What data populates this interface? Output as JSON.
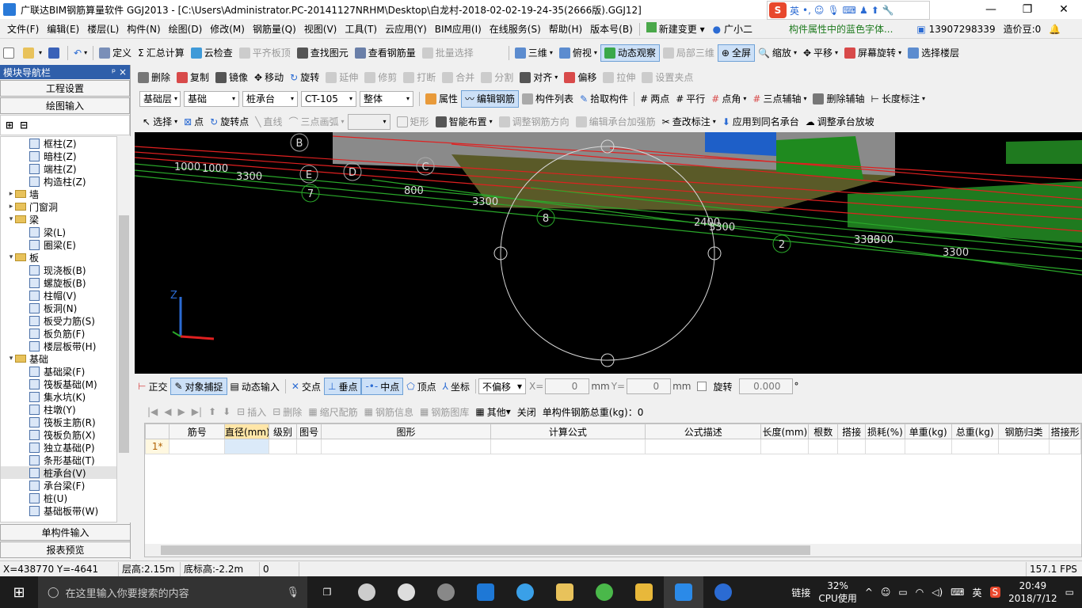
{
  "title": "广联达BIM钢筋算量软件 GGJ2013 - [C:\\Users\\Administrator.PC-20141127NRHM\\Desktop\\白龙村-2018-02-02-19-24-35(2666版).GGJ12]",
  "ime": {
    "lang": "英"
  },
  "menu": [
    "文件(F)",
    "编辑(E)",
    "楼层(L)",
    "构件(N)",
    "绘图(D)",
    "修改(M)",
    "钢筋量(Q)",
    "视图(V)",
    "工具(T)",
    "云应用(Y)",
    "BIM应用(I)",
    "在线服务(S)",
    "帮助(H)",
    "版本号(B)"
  ],
  "menu_extra": {
    "new_change": "新建变更",
    "guang_xiao_er": "广小二",
    "hint": "构件属性中的蓝色字体...",
    "phone": "13907298339",
    "zaojiadou": "造价豆:0"
  },
  "toolbar1": [
    "定义",
    "汇总计算",
    "云检查",
    "平齐板顶",
    "查找图元",
    "查看钢筋量",
    "批量选择",
    "三维",
    "俯视",
    "动态观察",
    "局部三维",
    "全屏",
    "缩放",
    "平移",
    "屏幕旋转",
    "选择楼层"
  ],
  "toolbar2": [
    "删除",
    "复制",
    "镜像",
    "移动",
    "旋转",
    "延伸",
    "修剪",
    "打断",
    "合并",
    "分割",
    "对齐",
    "偏移",
    "拉伸",
    "设置夹点"
  ],
  "toolbar3": {
    "combos": [
      "基础层",
      "基础",
      "桩承台",
      "CT-105",
      "整体"
    ],
    "buttons": [
      "属性",
      "编辑钢筋",
      "构件列表",
      "拾取构件",
      "两点",
      "平行",
      "点角",
      "三点辅轴",
      "删除辅轴",
      "长度标注"
    ]
  },
  "toolbar4": [
    "选择",
    "点",
    "旋转点",
    "直线",
    "三点画弧",
    "矩形",
    "智能布置",
    "调整钢筋方向",
    "编辑承台加强筋",
    "查改标注",
    "应用到同名承台",
    "调整承台放坡"
  ],
  "nav": {
    "header": "模块导航栏",
    "pin": "ᵖ ×",
    "engineering": "工程设置",
    "drawing": "绘图输入",
    "single": "单构件输入",
    "report": "报表预览",
    "tree": [
      {
        "label": "框柱(Z)",
        "level": 2
      },
      {
        "label": "暗柱(Z)",
        "level": 2
      },
      {
        "label": "端柱(Z)",
        "level": 2
      },
      {
        "label": "构造柱(Z)",
        "level": 2
      },
      {
        "label": "墙",
        "level": 1,
        "folder": true,
        "open": false
      },
      {
        "label": "门窗洞",
        "level": 1,
        "folder": true,
        "open": false
      },
      {
        "label": "梁",
        "level": 1,
        "folder": true,
        "open": true
      },
      {
        "label": "梁(L)",
        "level": 2
      },
      {
        "label": "圈梁(E)",
        "level": 2
      },
      {
        "label": "板",
        "level": 1,
        "folder": true,
        "open": true
      },
      {
        "label": "现浇板(B)",
        "level": 2
      },
      {
        "label": "螺旋板(B)",
        "level": 2
      },
      {
        "label": "柱帽(V)",
        "level": 2
      },
      {
        "label": "板洞(N)",
        "level": 2
      },
      {
        "label": "板受力筋(S)",
        "level": 2
      },
      {
        "label": "板负筋(F)",
        "level": 2
      },
      {
        "label": "楼层板带(H)",
        "level": 2
      },
      {
        "label": "基础",
        "level": 1,
        "folder": true,
        "open": true
      },
      {
        "label": "基础梁(F)",
        "level": 2
      },
      {
        "label": "筏板基础(M)",
        "level": 2
      },
      {
        "label": "集水坑(K)",
        "level": 2
      },
      {
        "label": "柱墩(Y)",
        "level": 2
      },
      {
        "label": "筏板主筋(R)",
        "level": 2
      },
      {
        "label": "筏板负筋(X)",
        "level": 2
      },
      {
        "label": "独立基础(P)",
        "level": 2
      },
      {
        "label": "条形基础(T)",
        "level": 2
      },
      {
        "label": "桩承台(V)",
        "level": 2,
        "selected": true
      },
      {
        "label": "承台梁(F)",
        "level": 2
      },
      {
        "label": "桩(U)",
        "level": 2
      },
      {
        "label": "基础板带(W)",
        "level": 2
      }
    ]
  },
  "view": {
    "dims": [
      "1000",
      "1000",
      "3300",
      "800",
      "3300",
      "2400",
      "3300",
      "3300",
      "3300",
      "3300"
    ],
    "axis_labels": [
      "B",
      "E",
      "D",
      "C",
      "7",
      "8",
      "2"
    ]
  },
  "snapbar": {
    "buttons": [
      "正交",
      "对象捕捉",
      "动态输入",
      "交点",
      "垂点",
      "中点",
      "顶点",
      "坐标"
    ],
    "offset": "不偏移",
    "x_label": "X=",
    "x_value": "0",
    "y_label": "Y=",
    "y_value": "0",
    "unit": "mm",
    "rotate_label": "旋转",
    "rotate_value": "0.000",
    "deg": "°"
  },
  "rebar_toolbar": {
    "buttons": [
      "插入",
      "删除",
      "缩尺配筋",
      "钢筋信息",
      "钢筋图库",
      "其他",
      "关闭"
    ],
    "total": "单构件钢筋总重(kg)：0"
  },
  "grid": {
    "columns": [
      "筋号",
      "直径(mm)",
      "级别",
      "图号",
      "图形",
      "计算公式",
      "公式描述",
      "长度(mm)",
      "根数",
      "搭接",
      "损耗(%)",
      "单重(kg)",
      "总重(kg)",
      "钢筋归类",
      "搭接形"
    ],
    "rows": [
      {
        "num": "1*"
      }
    ]
  },
  "status": {
    "coords": "X=438770 Y=-4641",
    "floor_height": "层高:2.15m",
    "bottom_elev": "底标高:-2.2m",
    "zero": "0",
    "fps": "157.1 FPS"
  },
  "taskbar": {
    "search_placeholder": "在这里输入你要搜索的内容",
    "link": "链接",
    "cpu": "32%",
    "cpu_label": "CPU使用",
    "lang": "英",
    "time": "20:49",
    "date": "2018/7/12"
  }
}
